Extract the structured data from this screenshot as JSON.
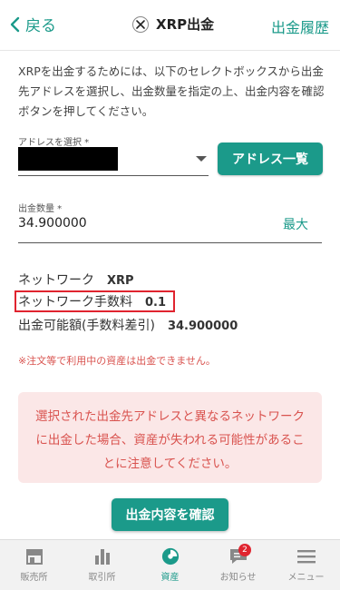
{
  "header": {
    "back_label": "戻る",
    "title": "XRP出金",
    "history_label": "出金履歴"
  },
  "intro_text": "XRPを出金するためには、以下のセレクトボックスから出金先アドレスを選択し、出金数量を指定の上、出金内容を確認ボタンを押してください。",
  "address": {
    "label": "アドレスを選択 *",
    "list_button": "アドレス一覧"
  },
  "amount": {
    "label": "出金数量 *",
    "value": "34.900000",
    "max_label": "最大"
  },
  "info": {
    "network_label": "ネットワーク",
    "network_value": "XRP",
    "fee_label": "ネットワーク手数料",
    "fee_value": "0.1",
    "available_label": "出金可能額(手数料差引)",
    "available_value": "34.900000"
  },
  "warning_note": "※注文等で利用中の資産は出金できません。",
  "alert_text": "選択された出金先アドレスと異なるネットワークに出金した場合、資産が失われる可能性があることに注意してください。",
  "confirm_button": "出金内容を確認",
  "nav": {
    "items": [
      {
        "label": "販売所",
        "icon": "shop-icon"
      },
      {
        "label": "取引所",
        "icon": "chart-bar-icon"
      },
      {
        "label": "資産",
        "icon": "pie-chart-icon"
      },
      {
        "label": "お知らせ",
        "icon": "chat-icon",
        "badge": "2"
      },
      {
        "label": "メニュー",
        "icon": "hamburger-icon"
      }
    ]
  },
  "colors": {
    "accent": "#1b9a8a",
    "alert_bg": "#fbe7e7",
    "alert_text": "#d9534f",
    "highlight_border": "#e0242f"
  }
}
